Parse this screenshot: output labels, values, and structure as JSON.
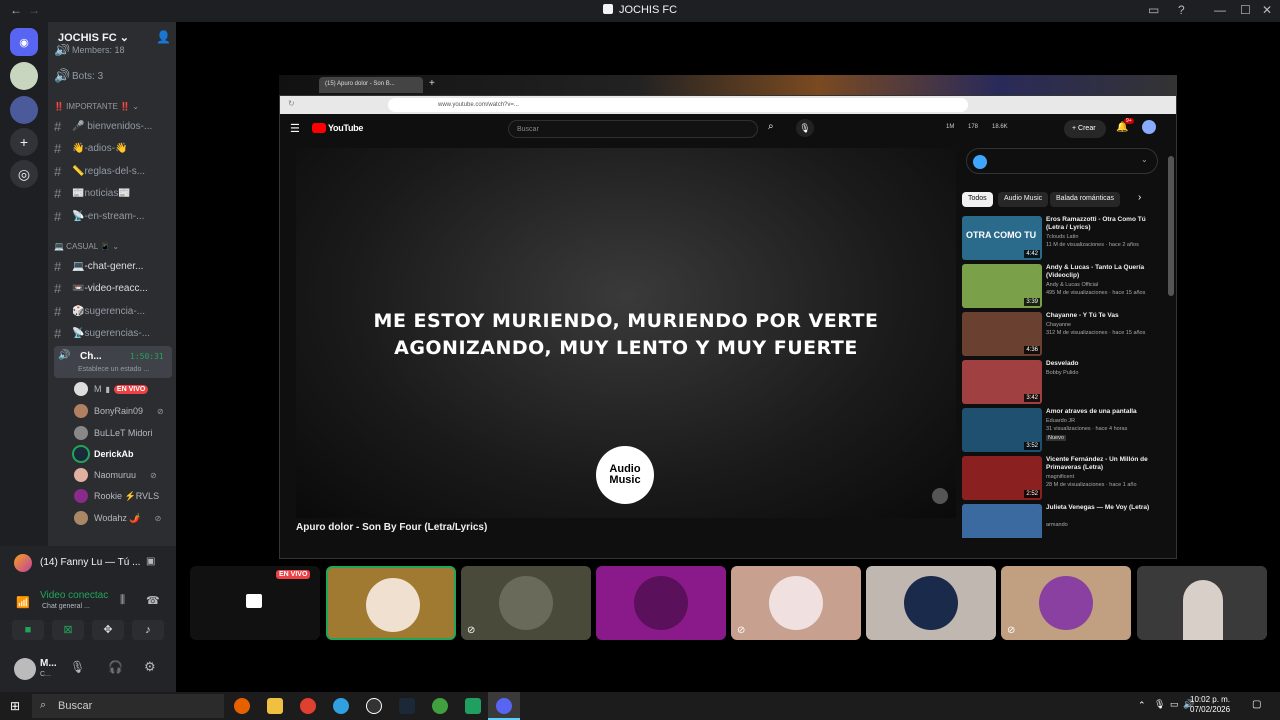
{
  "window": {
    "title": "JOCHIS FC"
  },
  "server": {
    "name": "JOCHIS FC",
    "members": "Members: 18",
    "bots": "Bots: 3"
  },
  "categories": [
    {
      "label": "‼️ IMPORTANTE ‼️"
    },
    {
      "label": "💻 CASUAL 📱"
    }
  ],
  "channels": [
    {
      "name": "🎤 bienvenidos-..."
    },
    {
      "name": "👋-adios-👋"
    },
    {
      "name": "📏reglas-del-s..."
    },
    {
      "name": "📰noticias📰"
    },
    {
      "name": "📡-en-stream-..."
    },
    {
      "name": "💻-chat-gener..."
    },
    {
      "name": "📼-video-reacc..."
    },
    {
      "name": "🎲sugerencia-..."
    },
    {
      "name": "📡sugerencias-..."
    }
  ],
  "voice": {
    "channel": "Ch...",
    "timer": "1:50:31",
    "status": "Establece un estado ...",
    "live": "EN VIVO",
    "users": [
      {
        "name": "M"
      },
      {
        "name": "BonyRain09"
      },
      {
        "name": "BuLLeT Midori"
      },
      {
        "name": "DerickAb"
      },
      {
        "name": "Naomuruu"
      },
      {
        "name": "Rookie ⚡RVLS"
      },
      {
        "name": "Wodahz 🌶️"
      }
    ]
  },
  "nowplaying": "(14) Fanny Lu — Tú ...",
  "connection": {
    "status": "Video conectac",
    "sub": "Chat general ..."
  },
  "self": {
    "name": "M...",
    "sub": "C..."
  },
  "browser": {
    "tab": "(15) Apuro dolor - Son B...",
    "url": "www.youtube.com/watch?v=...",
    "search_placeholder": "Buscar",
    "create": "Crear",
    "stats": [
      "1M",
      "178",
      "18.6K"
    ],
    "notif": "9+"
  },
  "video": {
    "lyric1": "ME ESTOY MURIENDO, MURIENDO POR VERTE",
    "lyric2": "AGONIZANDO, MUY LENTO Y MUY FUERTE",
    "logo_line1": "Audio",
    "logo_line2": "Music",
    "title": "Apuro dolor - Son By Four (Letra/Lyrics)"
  },
  "chips": [
    "Todos",
    "Audio Music",
    "Balada románticas"
  ],
  "related": [
    {
      "title": "Eros Ramazzotti - Otra Como Tú (Letra / Lyrics)",
      "channel": "7clouds Latin",
      "meta": "11 M de visualizaciones · hace 2 años",
      "dur": "4:42",
      "thumb_text": "OTRA COMO TU",
      "color": "#2a6a8a"
    },
    {
      "title": "Andy & Lucas - Tanto La Quería (Videoclip)",
      "channel": "Andy & Lucas Official",
      "meta": "495 M de visualizaciones · hace 15 años",
      "dur": "3:39",
      "color": "#7aa04a"
    },
    {
      "title": "Chayanne - Y Tú Te Vas",
      "channel": "Chayanne",
      "meta": "312 M de visualizaciones · hace 15 años",
      "dur": "4:36",
      "color": "#6a4030"
    },
    {
      "title": "Desvelado",
      "channel": "Bobby Pulido",
      "meta": "",
      "dur": "3:42",
      "color": "#a04040"
    },
    {
      "title": "Amor atraves de una pantalla",
      "channel": "Eduardo JR",
      "meta": "31 visualizaciones · hace 4 horas",
      "badge": "Nuevo",
      "dur": "3:52",
      "color": "#205070"
    },
    {
      "title": "Vicente Fernández - Un Millón de Primaveras (Letra)",
      "channel": "magnificent",
      "meta": "28 M de visualizaciones · hace 1 año",
      "dur": "2:52",
      "color": "#8a2020"
    },
    {
      "title": "Julieta Venegas — Me Voy (Letra)",
      "channel": "armando",
      "meta": "",
      "dur": "",
      "color": "#3a6aa0"
    }
  ],
  "tiles": [
    {
      "name": "stream-tile-live",
      "color": "#111111",
      "live": "EN VIVO"
    },
    {
      "name": "tile-bonyrain",
      "color": "#a07a30"
    },
    {
      "name": "tile-bullet",
      "color": "#4a4a3a"
    },
    {
      "name": "tile-derick",
      "color": "#8a1a8a"
    },
    {
      "name": "tile-naomuruu",
      "color": "#c8a090"
    },
    {
      "name": "tile-rookie",
      "color": "#c0b8b0"
    },
    {
      "name": "tile-wodahz",
      "color": "#c0a080"
    },
    {
      "name": "tile-camera",
      "color": "#3a3a3a"
    }
  ],
  "taskbar": {
    "search": "Buscar",
    "time": "10:02 p. m.",
    "date": "07/02/2026"
  },
  "colors": {
    "accent": "#5865f2",
    "live": "#ed4245",
    "online": "#23a559"
  }
}
